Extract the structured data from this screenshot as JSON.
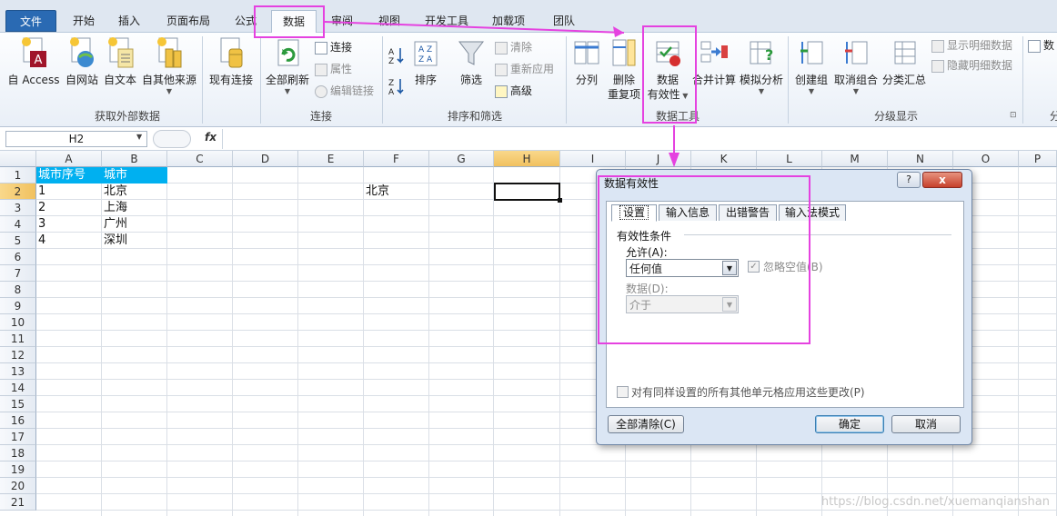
{
  "tabs": {
    "file": "文件",
    "home": "开始",
    "insert": "插入",
    "page_layout": "页面布局",
    "formulas": "公式",
    "data": "数据",
    "review": "审阅",
    "view": "视图",
    "developer": "开发工具",
    "addins": "加载项",
    "team": "团队"
  },
  "ribbon": {
    "get_external": {
      "access": "自 Access",
      "web": "自网站",
      "text": "自文本",
      "other": "自其他来源",
      "existing": "现有连接",
      "label": "获取外部数据"
    },
    "connections": {
      "refresh_all": "全部刷新",
      "connections": "连接",
      "properties": "属性",
      "edit_links": "编辑链接",
      "label": "连接"
    },
    "sort_filter": {
      "sort": "排序",
      "filter": "筛选",
      "clear": "清除",
      "reapply": "重新应用",
      "advanced": "高级",
      "label": "排序和筛选"
    },
    "data_tools": {
      "text_to_columns": "分列",
      "remove_dup_1": "删除",
      "remove_dup_2": "重复项",
      "validation_1": "数据",
      "validation_2": "有效性",
      "consolidate": "合并计算",
      "whatif": "模拟分析",
      "label": "数据工具"
    },
    "outline": {
      "group": "创建组",
      "ungroup": "取消组合",
      "subtotal": "分类汇总",
      "show_detail": "显示明细数据",
      "hide_detail": "隐藏明细数据",
      "label": "分级显示"
    },
    "analysis_partial": "数",
    "analysis_label_partial": "分"
  },
  "formula_bar": {
    "name_box": "H2",
    "fx": "fx",
    "value": ""
  },
  "columns": [
    "A",
    "B",
    "C",
    "D",
    "E",
    "F",
    "G",
    "H",
    "I",
    "J",
    "K",
    "L",
    "M",
    "N",
    "O",
    "P"
  ],
  "rows": [
    "1",
    "2",
    "3",
    "4",
    "5",
    "6",
    "7",
    "8",
    "9",
    "10",
    "11",
    "12",
    "13",
    "14",
    "15",
    "16",
    "17",
    "18",
    "19",
    "20",
    "21"
  ],
  "cells": {
    "A1": "城市序号",
    "B1": "城市",
    "A2": "1",
    "B2": "北京",
    "A3": "2",
    "B3": "上海",
    "A4": "3",
    "B4": "广州",
    "A5": "4",
    "B5": "深圳",
    "F2": "北京"
  },
  "dialog": {
    "title": "数据有效性",
    "help": "?",
    "close": "x",
    "tabs": [
      "设置",
      "输入信息",
      "出错警告",
      "输入法模式"
    ],
    "criteria_heading": "有效性条件",
    "allow_label": "允许(A):",
    "allow_value": "任何值",
    "ignore_blank": "忽略空值(B)",
    "data_label": "数据(D):",
    "data_value": "介于",
    "apply_all": "对有同样设置的所有其他单元格应用这些更改(P)",
    "clear_all": "全部清除(C)",
    "ok": "确定",
    "cancel": "取消"
  },
  "watermark": "https://blog.csdn.net/xuemanqianshan",
  "colors": {
    "accent_pink": "#e542e0",
    "header_fill": "#00b0f0",
    "file_tab": "#2a6ab3"
  }
}
